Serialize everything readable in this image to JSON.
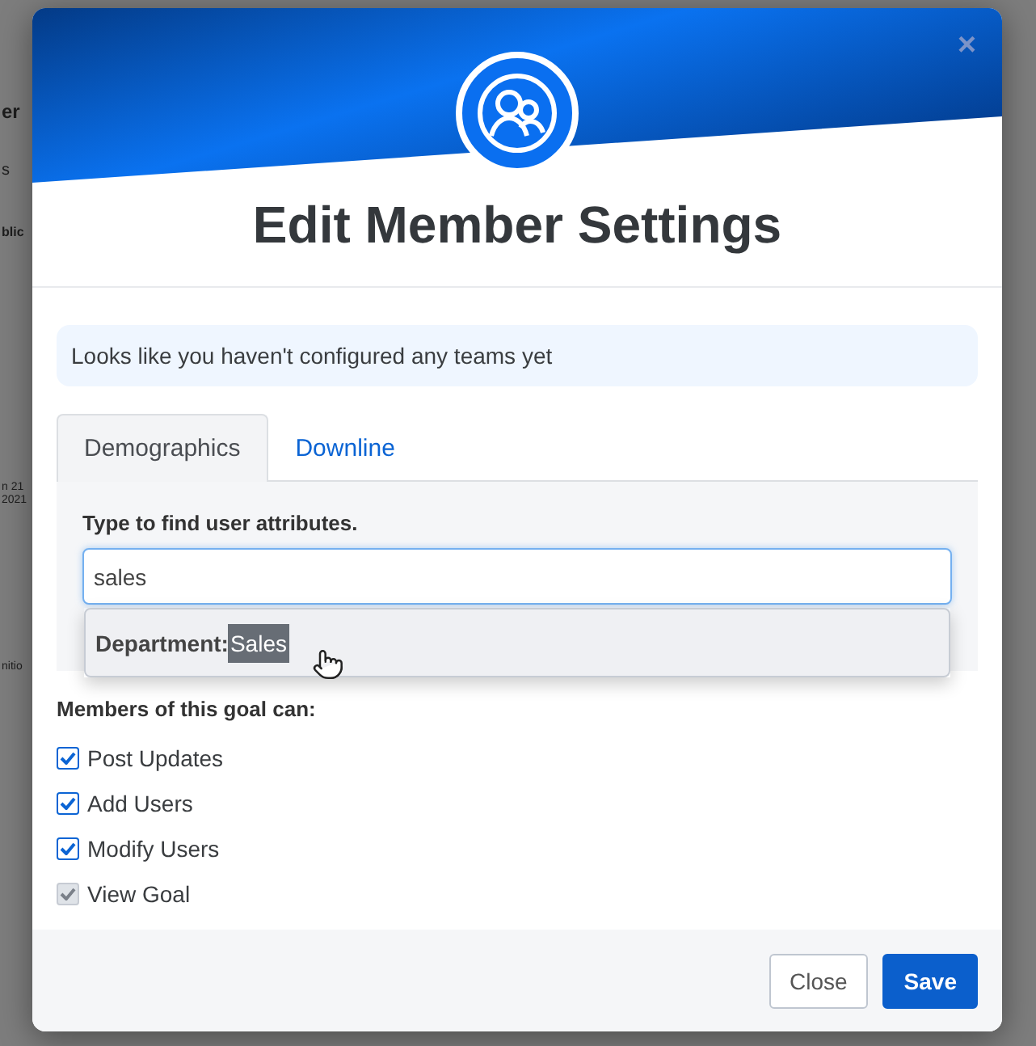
{
  "background": {
    "fragments": [
      "er",
      "s",
      "blic",
      "n 21",
      "2021",
      "nitio"
    ]
  },
  "modal": {
    "close": "×",
    "title": "Edit Member Settings",
    "notice": "Looks like you haven't configured any teams yet",
    "tabs": [
      {
        "label": "Demographics",
        "selected": true
      },
      {
        "label": "Downline",
        "selected": false
      }
    ],
    "search": {
      "label": "Type to find user attributes.",
      "value": "sales",
      "suggestions": [
        {
          "prefix": "Department:",
          "match": "Sales"
        }
      ]
    },
    "permissions": {
      "heading": "Members of this goal can:",
      "items": [
        {
          "label": "Post Updates",
          "checked": true,
          "disabled": false
        },
        {
          "label": "Add Users",
          "checked": true,
          "disabled": false
        },
        {
          "label": "Modify Users",
          "checked": true,
          "disabled": false
        },
        {
          "label": "View Goal",
          "checked": true,
          "disabled": true
        }
      ]
    },
    "buttons": [
      {
        "label": "Close",
        "kind": "secondary"
      },
      {
        "label": "Save",
        "kind": "primary"
      }
    ]
  }
}
